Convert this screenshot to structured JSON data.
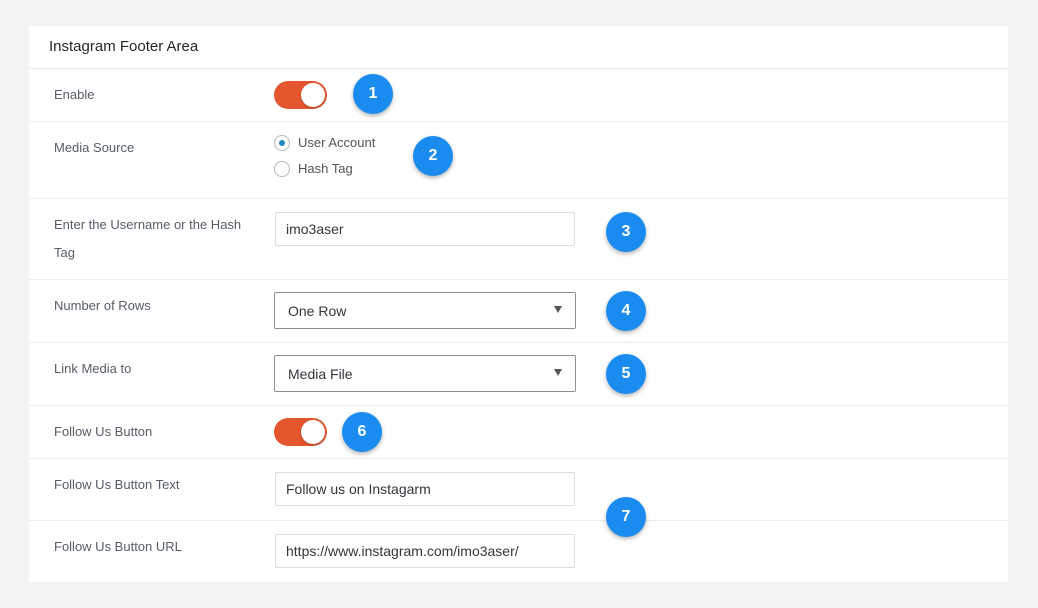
{
  "panel": {
    "title": "Instagram Footer Area"
  },
  "enable": {
    "label": "Enable",
    "on": true,
    "badge": "1"
  },
  "media_source": {
    "label": "Media Source",
    "options": [
      {
        "label": "User Account",
        "checked": true
      },
      {
        "label": "Hash Tag",
        "checked": false
      }
    ],
    "badge": "2"
  },
  "username": {
    "label": "Enter the Username or the Hash Tag",
    "value": "imo3aser",
    "badge": "3"
  },
  "rows": {
    "label": "Number of Rows",
    "selected": "One Row",
    "badge": "4"
  },
  "link_media": {
    "label": "Link Media to",
    "selected": "Media File",
    "badge": "5"
  },
  "follow_button": {
    "label": "Follow Us Button",
    "on": true,
    "badge": "6"
  },
  "follow_text": {
    "label": "Follow Us Button Text",
    "value": "Follow us on Instagarm"
  },
  "follow_url": {
    "label": "Follow Us Button URL",
    "value": "https://www.instagram.com/imo3aser/"
  },
  "follow_badge": "7",
  "colors": {
    "accent_toggle": "#e4572e",
    "badge": "#1a8cf0",
    "radio_dot": "#1e8cbe"
  }
}
